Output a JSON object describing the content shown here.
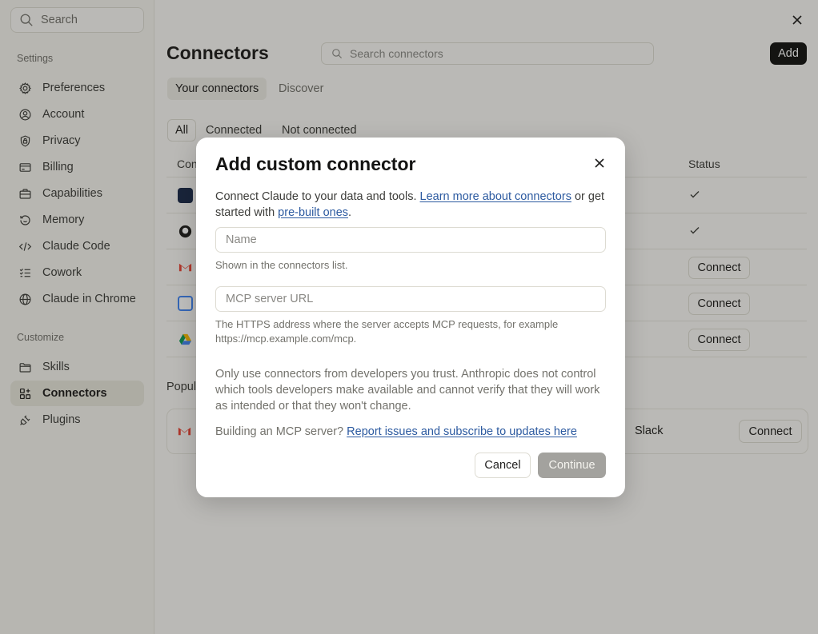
{
  "sidebar": {
    "search_placeholder": "Search",
    "settings_heading": "Settings",
    "settings_items": [
      {
        "label": "Preferences",
        "icon": "gear-icon"
      },
      {
        "label": "Account",
        "icon": "user-circle-icon"
      },
      {
        "label": "Privacy",
        "icon": "lock-shield-icon"
      },
      {
        "label": "Billing",
        "icon": "credit-card-icon"
      },
      {
        "label": "Capabilities",
        "icon": "briefcase-icon"
      },
      {
        "label": "Memory",
        "icon": "history-icon"
      },
      {
        "label": "Claude Code",
        "icon": "code-icon"
      },
      {
        "label": "Cowork",
        "icon": "checklist-icon"
      },
      {
        "label": "Claude in Chrome",
        "icon": "globe-icon"
      }
    ],
    "customize_heading": "Customize",
    "customize_items": [
      {
        "label": "Skills",
        "icon": "folder-icon"
      },
      {
        "label": "Connectors",
        "icon": "grid-plus-icon",
        "active": true
      },
      {
        "label": "Plugins",
        "icon": "plug-icon"
      }
    ]
  },
  "main": {
    "title": "Connectors",
    "search_placeholder": "Search connectors",
    "add_label": "Add",
    "tabs": [
      {
        "label": "Your connectors",
        "active": true
      },
      {
        "label": "Discover",
        "active": false
      }
    ],
    "filters": [
      {
        "label": "All",
        "active": true
      },
      {
        "label": "Connected",
        "active": false
      },
      {
        "label": "Not connected",
        "active": false
      }
    ],
    "columns": {
      "name_partial": "Con",
      "status": "Status"
    },
    "rows": [
      {
        "status": "connected"
      },
      {
        "status": "connected"
      },
      {
        "status": "Connect"
      },
      {
        "status": "Connect"
      },
      {
        "status": "Connect"
      }
    ],
    "popular_title_partial": "Popul",
    "popular_slack": "Slack",
    "popular_connect": "Connect"
  },
  "dialog": {
    "title": "Add custom connector",
    "intro_text": "Connect Claude to your data and tools. ",
    "intro_link1": "Learn more about connectors",
    "intro_mid": " or get started with ",
    "intro_link2": "pre-built ones",
    "intro_end": ".",
    "name_placeholder": "Name",
    "name_help": "Shown in the connectors list.",
    "url_placeholder": "MCP server URL",
    "url_help": "The HTTPS address where the server accepts MCP requests, for example https://mcp.example.com/mcp.",
    "warning": "Only use connectors from developers you trust. Anthropic does not control which tools developers make available and cannot verify that they will work as intended or that they won't change.",
    "building_text": "Building an MCP server? ",
    "building_link": "Report issues and subscribe to updates here",
    "cancel_label": "Cancel",
    "continue_label": "Continue"
  },
  "colors": {
    "accent_link": "#2c5aa0",
    "primary_button": "#141413",
    "continue_disabled": "#a3a29e"
  }
}
